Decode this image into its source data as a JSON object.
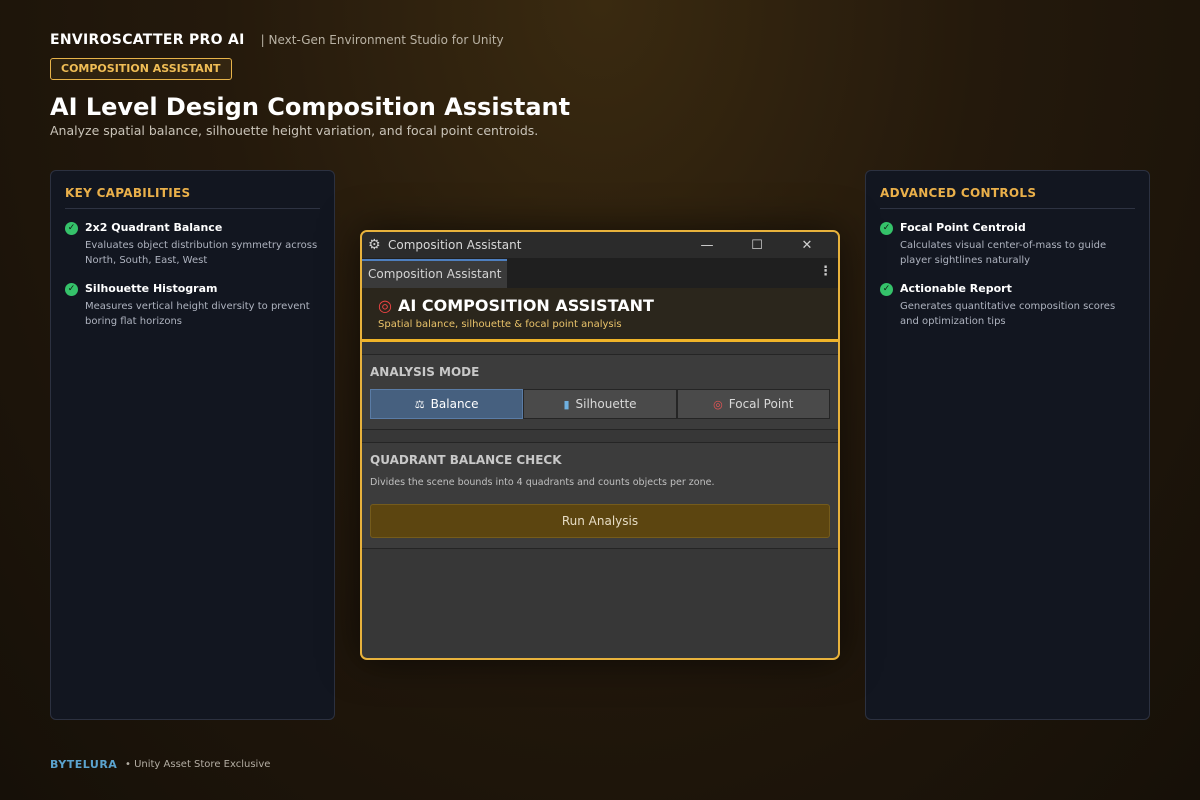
{
  "brand": {
    "name": "ENVIROSCATTER PRO AI",
    "tagline": "|  Next-Gen Environment Studio for Unity",
    "badge": "COMPOSITION ASSISTANT"
  },
  "page": {
    "title": "AI Level Design Composition Assistant",
    "subtitle": "Analyze spatial balance, silhouette height variation, and focal point centroids."
  },
  "left_panel": {
    "heading": "KEY CAPABILITIES",
    "items": [
      {
        "title": "2x2 Quadrant Balance",
        "desc": "Evaluates object distribution symmetry across North, South, East, West"
      },
      {
        "title": "Silhouette Histogram",
        "desc": "Measures vertical height diversity to prevent boring flat horizons"
      }
    ]
  },
  "right_panel": {
    "heading": "ADVANCED CONTROLS",
    "items": [
      {
        "title": "Focal Point Centroid",
        "desc": "Calculates visual center-of-mass to guide player sightlines naturally"
      },
      {
        "title": "Actionable Report",
        "desc": "Generates quantitative composition scores and optimization tips"
      }
    ]
  },
  "window": {
    "title": "Composition Assistant",
    "tab": "Composition Assistant",
    "header_title": "AI COMPOSITION ASSISTANT",
    "header_subtitle": "Spatial balance, silhouette & focal point analysis",
    "mode_label": "ANALYSIS MODE",
    "modes": [
      {
        "label": "Balance",
        "icon": "⚖",
        "active": true
      },
      {
        "label": "Silhouette",
        "icon": "▮",
        "active": false
      },
      {
        "label": "Focal Point",
        "icon": "◎",
        "active": false
      }
    ],
    "check_label": "QUADRANT BALANCE CHECK",
    "check_desc": "Divides the scene bounds into 4 quadrants and counts objects per zone.",
    "run_label": "Run Analysis"
  },
  "footer": {
    "brand": "BYTELURA",
    "note": "•  Unity Asset Store Exclusive"
  },
  "colors": {
    "accent": "#e8b23c",
    "check": "#35c26a",
    "active_mode": "#46607f"
  }
}
